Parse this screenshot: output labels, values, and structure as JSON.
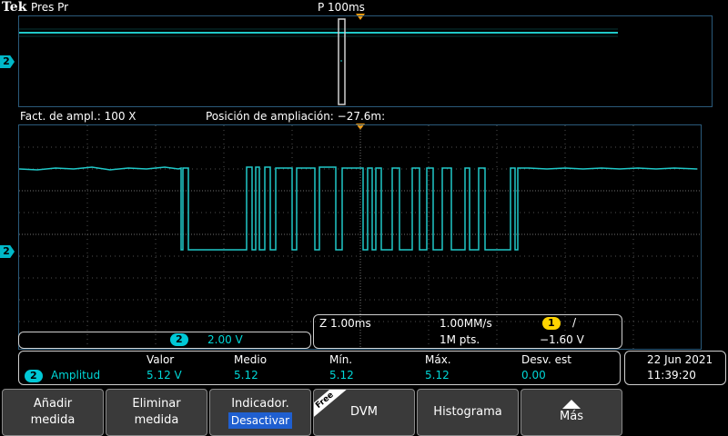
{
  "header": {
    "brand": "Tek",
    "mode": "Pres Pr",
    "position": "P 100ms"
  },
  "zoom_info": {
    "factor": "Fact. de ampl.: 100 X",
    "position": "Posición de ampliación: −27.6m:"
  },
  "channel": {
    "number": "2",
    "scale": "2.00 V"
  },
  "timebase": {
    "zoom": "Z 1.00ms",
    "rate": "1.00MM/s",
    "points": "1M pts.",
    "trigger_channel": "1",
    "trigger_slope": "/",
    "trigger_level": "−1.60 V"
  },
  "measurement": {
    "headers": [
      "Valor",
      "Medio",
      "Mín.",
      "Máx.",
      "Desv. est"
    ],
    "label": "Amplitud",
    "values": [
      "5.12 V",
      "5.12",
      "5.12",
      "5.12",
      "0.00"
    ]
  },
  "datetime": {
    "date": "22 Jun  2021",
    "time": "11:39:20"
  },
  "buttons": {
    "add_line1": "Añadir",
    "add_line2": "medida",
    "remove_line1": "Eliminar",
    "remove_line2": "medida",
    "indicator_line1": "Indicador.",
    "indicator_state": "Desactivar",
    "free_badge": "Free",
    "dvm": "DVM",
    "histogram": "Histograma",
    "more": "Más"
  },
  "colors": {
    "trace": "#20c8c8",
    "channel_marker": "#00b8c8",
    "trigger_marker": "#f39c12",
    "highlight": "#1f5fd0"
  }
}
